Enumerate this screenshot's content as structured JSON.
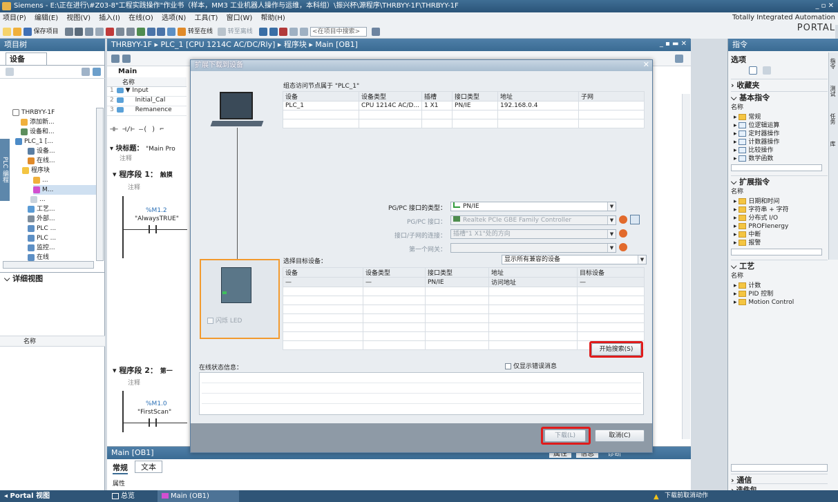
{
  "window": {
    "title": "Siemens - E:\\正在进行\\#Z03-8\"工程实践操作\"作业书（样本，MM3 工业机器人操作与运维，本科组）\\振兴杯\\源程序\\THRBYY-1F\\THRBYY-1F",
    "controls": "_ ▫ ✕"
  },
  "menu": [
    "项目(P)",
    "编辑(E)",
    "视图(V)",
    "插入(I)",
    "在线(O)",
    "选项(N)",
    "工具(T)",
    "窗口(W)",
    "帮助(H)"
  ],
  "toolbar": {
    "save_label": "保存项目",
    "go_online": "转至在线",
    "go_offline": "转至离线",
    "search_placeholder": "<在项目中搜索>"
  },
  "brand": {
    "line1": "Totally Integrated Automation",
    "line2": "PORTAL"
  },
  "project_tree": {
    "title": "项目树",
    "devices_tab": "设备",
    "items": [
      "THRBYY-1F",
      "添加新...",
      "设备和...",
      "PLC_1 [...",
      "设备...",
      "在线...",
      "程序块",
      "...",
      "M...",
      "...",
      "工艺...",
      "外部...",
      "PLC ...",
      "PLC ...",
      "监控...",
      "在线"
    ],
    "side_label": "PLC 编程",
    "detail_view": "详细视图",
    "name_col": "名称"
  },
  "editor": {
    "breadcrumb": "THRBYY-1F ▸ PLC_1 [CPU 1214C AC/DC/Rly] ▸ 程序块 ▸ Main [OB1]",
    "block_name": "Main",
    "iface_header": "名称",
    "iface_rows": [
      {
        "num": "1",
        "name": "▼ Input"
      },
      {
        "num": "2",
        "name": "Initial_Cal"
      },
      {
        "num": "3",
        "name": "Remanence"
      }
    ],
    "block_title_label": "块标题：",
    "block_title_value": "\"Main Pro",
    "comment": "注释",
    "network1_label": "程序段 1：",
    "network1_title": "触摸",
    "contact1_addr": "%M1.2",
    "contact1_name": "\"AlwaysTRUE\"",
    "network2_label": "程序段 2：",
    "network2_title": "第一",
    "contact2_addr": "%M1.0",
    "contact2_name": "\"FirstScan\"",
    "bottom_tab_name": "Main [OB1]",
    "props_tabs": [
      "常规",
      "文本"
    ],
    "props_row": "属性",
    "insp_tabs": [
      "属性",
      "信息",
      "诊断"
    ]
  },
  "right_panel": {
    "title": "指令",
    "options": "选项",
    "favorites": "收藏夹",
    "basic": "基本指令",
    "name_col": "名称",
    "basic_items": [
      "常规",
      "位逻辑运算",
      "定时器操作",
      "计数器操作",
      "比较操作",
      "数学函数"
    ],
    "extended": "扩展指令",
    "extended_items": [
      "日期和时间",
      "字符串 + 字符",
      "分布式 I/O",
      "PROFIenergy",
      "中断",
      "报警"
    ],
    "tech": "工艺",
    "tech_items": [
      "计数",
      "PID 控制",
      "Motion Control"
    ],
    "comm": "通信",
    "optpkg": "选件包",
    "vtabs": [
      "指令",
      "测试",
      "任务",
      "库"
    ]
  },
  "dialog": {
    "title": "扩展下载到设备",
    "nodes_label": "组态访问节点属于 \"PLC_1\"",
    "nodes_headers": [
      "设备",
      "设备类型",
      "插槽",
      "接口类型",
      "地址",
      "子网"
    ],
    "nodes_rows": [
      [
        "PLC_1",
        "CPU 1214C AC/D...",
        "1 X1",
        "PN/IE",
        "192.168.0.4",
        ""
      ]
    ],
    "pgpc_type_label": "PG/PC 接口的类型：",
    "pgpc_type_value": "PN/IE",
    "pgpc_iface_label": "PG/PC 接口：",
    "pgpc_iface_value": "Realtek PCIe GBE Family Controller",
    "subnet_label": "接口/子网的连接：",
    "subnet_value": "插槽\"1 X1\"处的方向",
    "gateway_label": "第一个网关：",
    "gateway_value": "",
    "target_label": "选择目标设备：",
    "target_filter": "显示所有兼容的设备",
    "target_headers": [
      "设备",
      "设备类型",
      "接口类型",
      "地址",
      "目标设备"
    ],
    "target_rows": [
      [
        "—",
        "—",
        "PN/IE",
        "访问地址",
        "—"
      ]
    ],
    "flash_led": "闪烁 LED",
    "start_search": "开始搜索(S)",
    "online_status_label": "在线状态信息：",
    "errors_only": "仅显示错误消息",
    "download_btn": "下载(L)",
    "cancel_btn": "取消(C)"
  },
  "statusbar": {
    "portal_view": "◂ Portal 视图",
    "overview": "总览",
    "main_tab": "Main (OB1)",
    "message": "下载前取消动作"
  },
  "colors": {
    "highlight": "#e01b1b",
    "title_blue": "#2a5478",
    "status_blue": "#2f5577",
    "selection_orange": "#f29a2e"
  }
}
